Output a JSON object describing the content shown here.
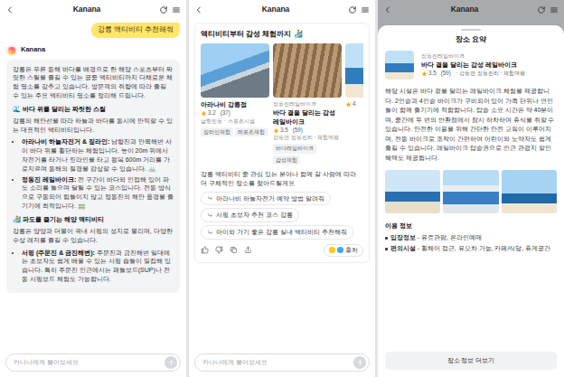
{
  "chat_screen": {
    "title": "Kanana",
    "user_message": "강릉 액티비티 추천해줘",
    "assistant_name": "Kanana",
    "blocks": [
      {
        "kind": "para",
        "text": "강릉은 푸른 동해 바다를 배경으로 한 해양 스포츠부터 짜릿한 스릴을 즐길 수 있는 공중 액티비티까지 다채로운 체험 명소를 갖추고 있습니다. 방문객의 취향에 따라 즐길 수 있는 주요 액티비티 명소를 정리해 드립니다."
      },
      {
        "kind": "heading",
        "text": "🌊 바다 위를 달리는 짜릿한 스릴"
      },
      {
        "kind": "para",
        "text": "강릉의 해안선을 따라 하늘과 바다를 동시에 만끽할 수 있는 대표적인 액티비티입니다."
      },
      {
        "kind": "bullet",
        "label": "아라나비 하늘자전거 & 짚라인:",
        "text": " 남항진과 안목해변 사이 바다 위를 횡단하는 체험입니다. 높이 20m 위에서 자전거를 타거나 짚라인을 타고 왕복 600m 거리를 가로지르며 동해의 절경을 감상할 수 있습니다. 🚲"
      },
      {
        "kind": "bullet",
        "label": "정동진 레일바이크:",
        "text": " 전 구간이 바다와 인접해 있어 파도 소리를 들으며 달릴 수 있는 코스입니다. 전동 방식으로 구동되어 힘들이지 않고 정동진의 해안 풍경을 즐기기에 최적입니다. 🚃"
      },
      {
        "kind": "heading",
        "text": "🏄 파도를 즐기는 해양 액티비티"
      },
      {
        "kind": "para",
        "text": "강릉은 양양과 더불어 국내 서핑의 성지로 불리며, 다양한 수상 레저를 즐길 수 있습니다."
      },
      {
        "kind": "bullet",
        "label": "서핑 (주문진 & 금진해변):",
        "text": " 주문진과 금진해변 일대에는 초보자도 쉽게 배울 수 있는 서핑 숍들이 밀집해 있습니다. 특히 주문진 인근에서는 패들보드(SUP)나 전동 서핑보드 체험도 가능합니다."
      }
    ],
    "input_placeholder": "카나나에게 물어보세요"
  },
  "results_screen": {
    "title": "Kanana",
    "card_title": "액티비티부터 감성 체험까지 🏄",
    "places": [
      {
        "name": "아라나비 강릉점",
        "rating": "3.2",
        "reviews": "(37)",
        "location": "남항진동 · 스포츠시설",
        "tags": [
          "짚라인체험",
          "레포츠체험"
        ]
      },
      {
        "subtitle": "정동진레일바이크",
        "name": "바다 곁을 달리는 감성 레일바이크",
        "rating": "3.5",
        "reviews": "(59)",
        "location": "강동면 정동진리 · 체험여행",
        "tags": [
          "바다레일바이크",
          "감성체험"
        ]
      },
      {
        "rating": "4."
      }
    ],
    "follow_text": "강릉 액티비티 중 관심 있는 분야나 함께 갈 사람에 따라 더 구체적인 장소를 찾아드릴게요",
    "suggestions": [
      "아라나비 하늘자전거 예약 방법 알려줘",
      "서핑 초보자 추천 코스 강릉",
      "아이와 가기 좋은 강릉 실내 액티비티 추천해줘"
    ],
    "source_label": "출처",
    "input_placeholder": "카나나에게 물어보세요"
  },
  "detail_screen": {
    "title": "Kanana",
    "sheet_title": "장소 요약",
    "place": {
      "subtitle": "정동진레일바이크",
      "name": "바다 곁을 달리는 감성 레일바이크",
      "rating": "3.5",
      "reviews": "(59)",
      "meta": "· 강동면 정동진리 · 체험여행"
    },
    "description": "해당 시설은 바다 곁을 달리는 레일바이크 체험을 제공합니다. 2인승과 4인승 바이크가 구비되어 있어 가족 단위나 연인들이 함께 즐기기에 적합합니다. 탑승 소요 시간은 약 40분이며, 중간에 두 번의 반환점에서 잠시 하차하여 휴식을 취할 수 있습니다. 안전한 이용을 위해 간단한 안전 교육이 이루어지며, 전동 바이크로 조작이 간편하여 어린이와 노약자도 쉽게 즐길 수 있습니다. 레일바이크 탑승권으로 인근 관광지 할인 혜택도 제공됩니다.",
    "info_title": "이용 정보",
    "info": [
      {
        "label": "입장정보",
        "value": "- 유료관람, 온라인예매"
      },
      {
        "label": "편의시설",
        "value": "- 휠체어 접근, 유모차 가능, 카페/식당, 휴게공간"
      }
    ],
    "button": "장소 정보 더보기"
  }
}
